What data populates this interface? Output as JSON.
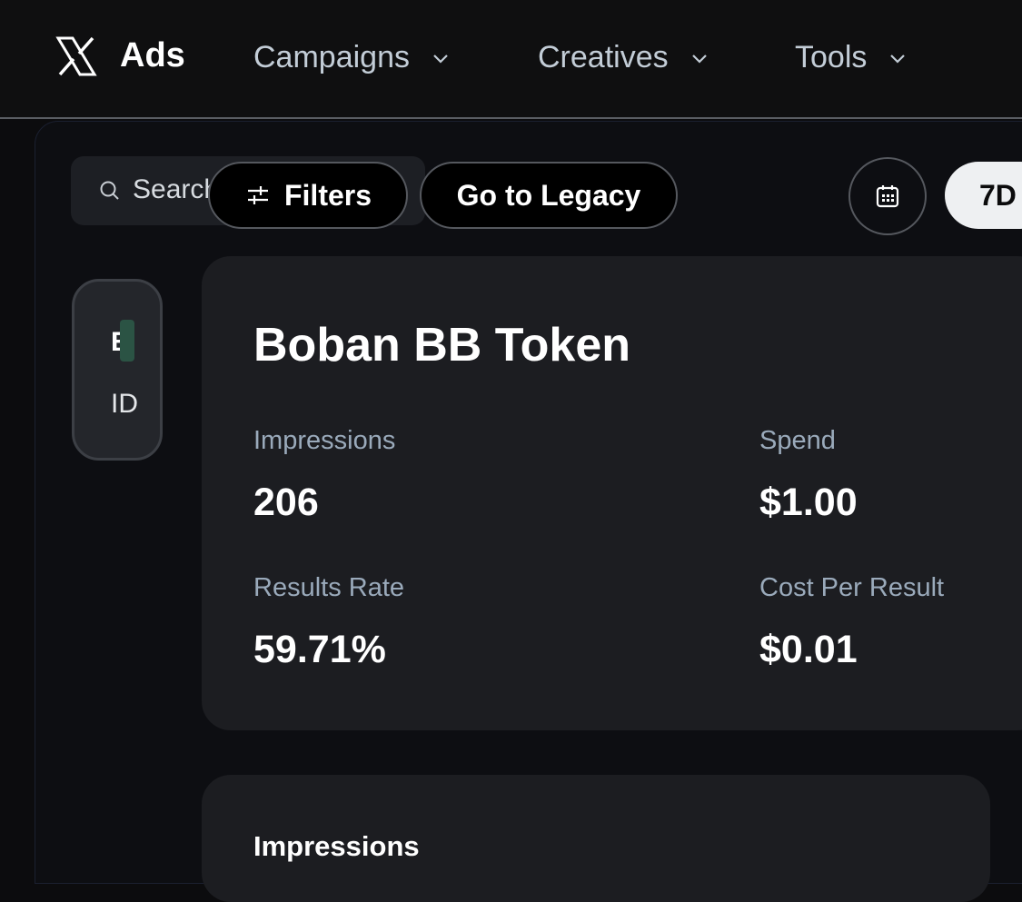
{
  "header": {
    "brand": "Ads",
    "nav": [
      {
        "label": "Campaigns"
      },
      {
        "label": "Creatives"
      },
      {
        "label": "Tools"
      }
    ]
  },
  "toolbar": {
    "search_placeholder": "Search",
    "filters_label": "Filters",
    "legacy_label": "Go to Legacy",
    "range_label": "7D"
  },
  "sidebar_card": {
    "letter": "E",
    "id_label": "ID"
  },
  "campaign": {
    "title": "Boban BB Token",
    "metrics": {
      "impressions": {
        "label": "Impressions",
        "value": "206"
      },
      "spend": {
        "label": "Spend",
        "value": "$1.00"
      },
      "results_rate": {
        "label": "Results Rate",
        "value": "59.71%"
      },
      "cost_per_result": {
        "label": "Cost Per Result",
        "value": "$0.01"
      }
    }
  },
  "impressions_card": {
    "title": "Impressions"
  },
  "colors": {
    "background": "#0c0c0e",
    "card": "#1c1d21",
    "muted_text": "#9aaabb",
    "nav_text": "#c3cdd7",
    "accent_green": "#2b5344"
  }
}
